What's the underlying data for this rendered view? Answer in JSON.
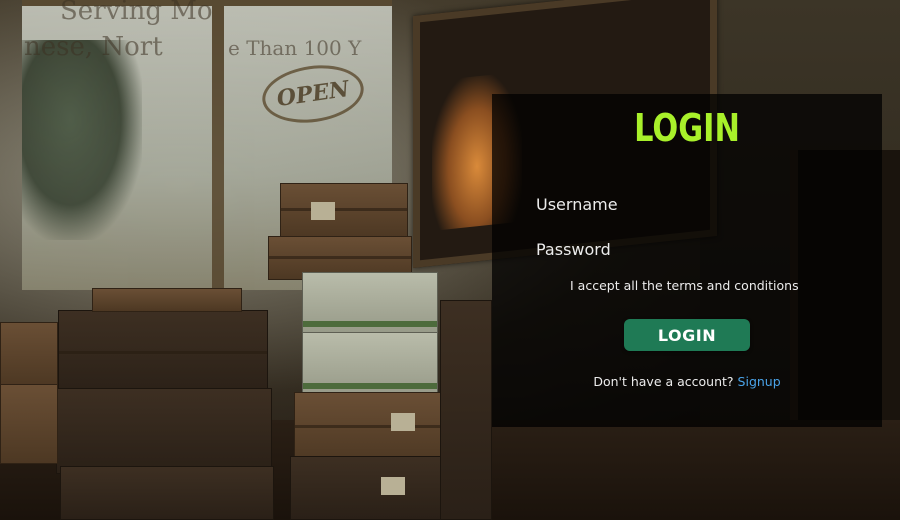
{
  "scene": {
    "window_text_line1": "Serving Mo",
    "window_text_line2": "nese, Nort",
    "window_text_line3": "e Than 100 Y",
    "open_sign": "OPEN"
  },
  "login": {
    "title": "LOGIN",
    "username_label": "Username",
    "username_value": "",
    "password_label": "Password",
    "password_value": "",
    "terms_text": "I accept all the terms and conditions",
    "terms_checked": false,
    "button_label": "LOGIN",
    "no_account_text": "Don't have a account?",
    "signup_label": "Signup"
  },
  "colors": {
    "title": "#a8f02a",
    "button": "#1f7a55",
    "link": "#4aa3e8",
    "panel_bg": "rgba(0,0,0,0.74)"
  }
}
